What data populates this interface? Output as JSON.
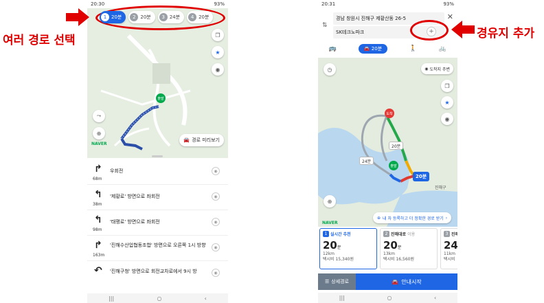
{
  "left": {
    "status": {
      "time": "20:30",
      "right": "93%"
    },
    "routes": [
      {
        "num": "1",
        "label": "20분",
        "active": true
      },
      {
        "num": "2",
        "label": "20분",
        "active": false
      },
      {
        "num": "3",
        "label": "24분",
        "active": false
      },
      {
        "num": "4",
        "label": "20분",
        "active": false
      }
    ],
    "preview_label": "경로 미리보기",
    "naver": "NAVER",
    "origin_label": "출발",
    "steps": [
      {
        "arrow": "↱",
        "dist": "68m",
        "text": "우회전"
      },
      {
        "arrow": "↰",
        "dist": "38m",
        "text": "'제황로' 방면으로 좌회전"
      },
      {
        "arrow": "↰",
        "dist": "98m",
        "text": "'태평로' 방면으로 좌회전"
      },
      {
        "arrow": "↱",
        "dist": "163m",
        "text": "'진해수산업협동조합' 방면으로 오른쪽 1시 방향"
      },
      {
        "arrow": "↶",
        "dist": "",
        "text": "'진해구청' 방면으로 회전교차로에서 9시 방"
      }
    ]
  },
  "right": {
    "status": {
      "time": "20:31",
      "right": "93%"
    },
    "start": "경남 창원시 진해구 제황산동 26-5",
    "end": "SK테크노파크",
    "add_symbol": "+",
    "close_symbol": "✕",
    "destination_around": "도착지 주변",
    "map_labels": {
      "arrive": "도착",
      "origin": "출발",
      "bubble_main": "20분",
      "bubble_a": "20분",
      "bubble_b": "24분",
      "district": "진해구"
    },
    "promo": "내 차 등록하고 더 정확한 경로 받기",
    "cards": [
      {
        "n": "1",
        "title": "실시간 추천",
        "extra": "",
        "time": "20",
        "unit": "분",
        "km": "12km",
        "fare": "택시비 15,340원",
        "active": true
      },
      {
        "n": "2",
        "title": "진해대로",
        "extra": "이용",
        "time": "20",
        "unit": "분",
        "km": "13km",
        "fare": "택시비 16,560원",
        "active": false
      },
      {
        "n": "3",
        "title": "진해",
        "extra": "",
        "time": "24",
        "unit": "",
        "km": "11km",
        "fare": "택시비",
        "active": false
      }
    ],
    "detail_label": "상세경로",
    "start_label": "안내시작"
  },
  "annotations": {
    "left_text": "여러 경로 선택",
    "right_text": "경유지 추가",
    "color": "#e00000"
  },
  "colors": {
    "accent": "#1f66e5",
    "route_green": "#03a94d"
  }
}
